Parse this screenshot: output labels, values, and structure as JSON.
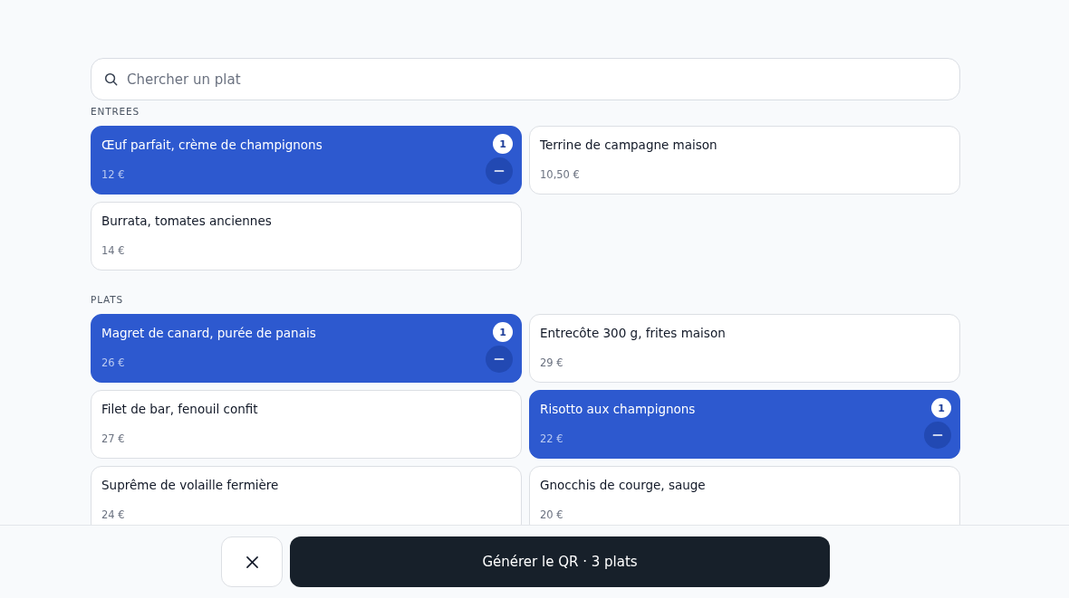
{
  "search": {
    "placeholder": "Chercher un plat"
  },
  "sections": [
    {
      "title": "ENTREES",
      "dishes": [
        {
          "name": "Œuf parfait, crème de champignons",
          "price": "12 €",
          "selected": true,
          "quantity": "1"
        },
        {
          "name": "Terrine de campagne maison",
          "price": "10,50 €",
          "selected": false
        },
        {
          "name": "Burrata, tomates anciennes",
          "price": "14 €",
          "selected": false
        }
      ]
    },
    {
      "title": "PLATS",
      "dishes": [
        {
          "name": "Magret de canard, purée de panais",
          "price": "26 €",
          "selected": true,
          "quantity": "1"
        },
        {
          "name": "Entrecôte 300 g, frites maison",
          "price": "29 €",
          "selected": false
        },
        {
          "name": "Filet de bar, fenouil confit",
          "price": "27 €",
          "selected": false
        },
        {
          "name": "Risotto aux champignons",
          "price": "22 €",
          "selected": true,
          "quantity": "1"
        },
        {
          "name": "Suprême de volaille fermière",
          "price": "24 €",
          "selected": false
        },
        {
          "name": "Gnocchis de courge, sauge",
          "price": "20 €",
          "selected": false
        }
      ]
    }
  ],
  "footer": {
    "generate_label": "Générer le QR · 3 plats"
  }
}
